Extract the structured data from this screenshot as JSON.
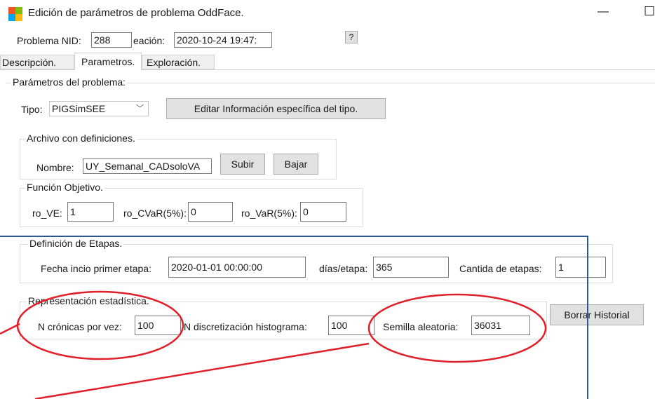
{
  "window": {
    "title": "Edición de parámetros de problema OddFace.",
    "minimize": "—",
    "maximize": "☐"
  },
  "header": {
    "nid_label": "Problema NID:",
    "nid_value": "288",
    "creation_label": "eación:",
    "creation_value": "2020-10-24 19:47:",
    "help_button": "?"
  },
  "tabs": [
    {
      "label": "Descripción."
    },
    {
      "label": "Parametros."
    },
    {
      "label": "Exploración."
    }
  ],
  "params_group": {
    "title": "Parámetros del problema:"
  },
  "tipo": {
    "label": "Tipo:",
    "value": "PIGSimSEE",
    "edit_button": "Editar Información específica del tipo."
  },
  "archivo": {
    "title": "Archivo con definiciones.",
    "nombre_label": "Nombre:",
    "nombre_value": "UY_Semanal_CADsoloVA",
    "subir": "Subir",
    "bajar": "Bajar"
  },
  "funcion": {
    "title": "Función Objetivo.",
    "ro_ve_label": "ro_VE:",
    "ro_ve_value": "1",
    "ro_cvar_label": "ro_CVaR(5%):",
    "ro_cvar_value": "0",
    "ro_var_label": "ro_VaR(5%):",
    "ro_var_value": "0"
  },
  "etapas": {
    "title": "Definición de Etapas.",
    "fecha_label": "Fecha incio primer etapa:",
    "fecha_value": "2020-01-01 00:00:00",
    "dias_label": "días/etapa:",
    "dias_value": "365",
    "cant_label": "Cantida de etapas:",
    "cant_value": "1"
  },
  "estadistica": {
    "title": "Representación estadística.",
    "cronicas_label": "N crónicas por vez:",
    "cronicas_value": "100",
    "histograma_label": "N discretización histograma:",
    "histograma_value": "100",
    "semilla_label": "Semilla aleatoria:",
    "semilla_value": "36031",
    "borrar_button": "Borrar Historial"
  },
  "annotation_colors": {
    "ellipse": "#e0202a",
    "rect": "#2b5a8c"
  }
}
